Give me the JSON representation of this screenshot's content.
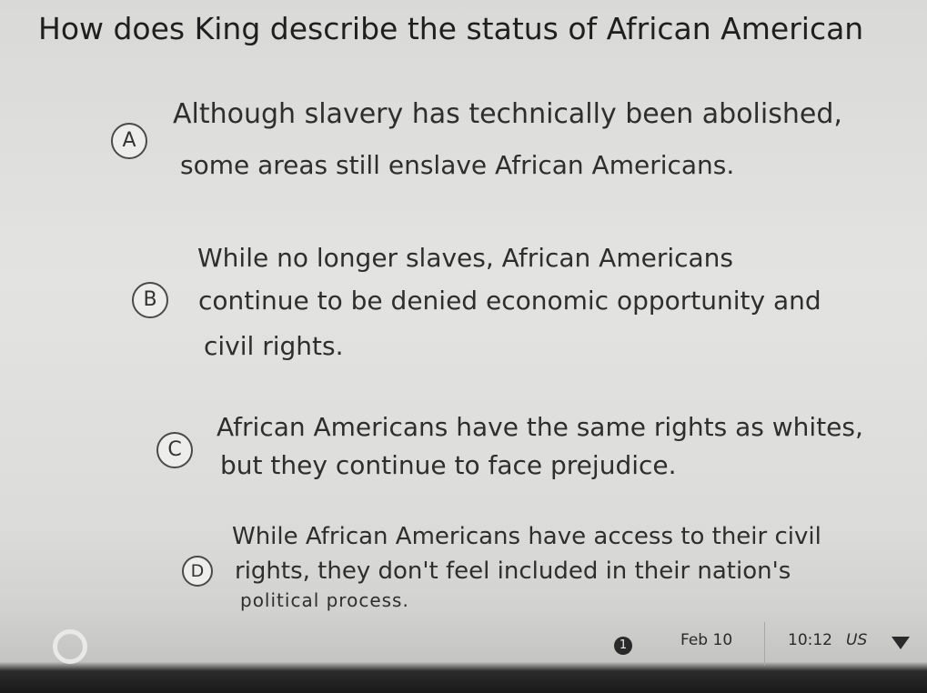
{
  "question": "How does King describe the status of African American",
  "options": [
    {
      "letter": "A",
      "lines": [
        "Although slavery has technically been abolished,",
        "some areas still enslave African Americans."
      ]
    },
    {
      "letter": "B",
      "lines": [
        "While no longer slaves, African Americans",
        "continue to be denied economic opportunity and",
        "civil rights."
      ]
    },
    {
      "letter": "C",
      "lines": [
        "African Americans have the same rights as whites,",
        "but they continue to face prejudice."
      ]
    },
    {
      "letter": "D",
      "lines": [
        "While African Americans have access to their civil",
        "rights, they don't feel included in their nation's",
        "political process."
      ]
    }
  ],
  "taskbar": {
    "notification_count": "1",
    "date": "Feb 10",
    "time": "10:12",
    "locale": "US",
    "launcher_icon": "launcher-circle-icon",
    "wifi_icon": "wifi-icon"
  }
}
